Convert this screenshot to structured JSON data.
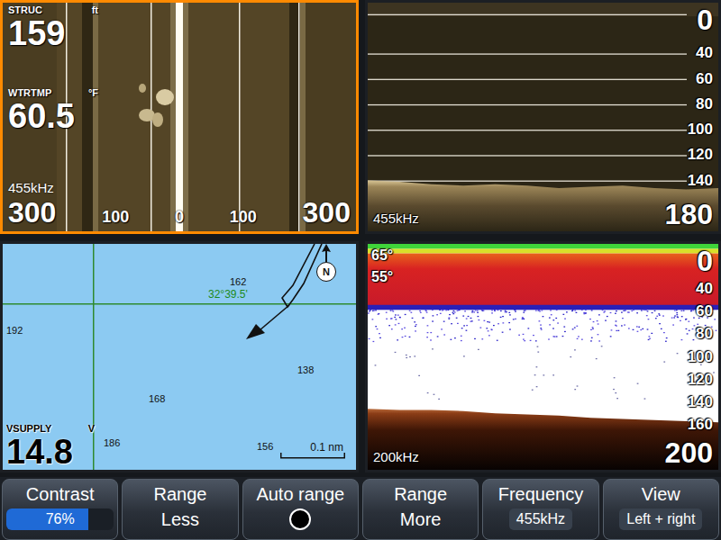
{
  "panels": {
    "structure": {
      "selected": true,
      "readouts": [
        {
          "label": "STRUC",
          "unit": "ft",
          "value": "159"
        },
        {
          "label": "WTRTMP",
          "unit": "°F",
          "value": "60.5"
        }
      ],
      "frequency": "455kHz",
      "scale": [
        "300",
        "100",
        "0",
        "100",
        "300"
      ]
    },
    "downscan": {
      "selected": false,
      "frequency": "455kHz",
      "range_top": "0",
      "range_bottom": "180",
      "ticks": [
        "40",
        "60",
        "80",
        "100",
        "120",
        "140"
      ],
      "bottom_depth": [
        140,
        141,
        143,
        144,
        143,
        144,
        146,
        145,
        144,
        146,
        147,
        146
      ]
    },
    "map": {
      "selected": false,
      "soundings": [
        "162",
        "192",
        "138",
        "168",
        "156",
        "186"
      ],
      "latitude": "32°39.5'",
      "north": "N",
      "scale": "0.1 nm",
      "readout": {
        "label": "VSUPPLY",
        "unit": "V",
        "value": "14.8"
      }
    },
    "sonar": {
      "selected": false,
      "frequency": "200kHz",
      "range_top": "0",
      "range_bottom": "200",
      "temperatures": [
        "65°",
        "55°"
      ],
      "ticks": [
        "40",
        "60",
        "80",
        "100",
        "120",
        "140",
        "160"
      ],
      "bottom_depth": [
        146,
        147,
        147,
        148,
        150,
        151,
        152,
        154,
        155,
        156,
        157,
        158
      ]
    }
  },
  "buttons": [
    {
      "label": "Contrast",
      "kind": "slider",
      "value": "76%",
      "level": 0.76
    },
    {
      "label": "Range",
      "kind": "text",
      "value": "Less"
    },
    {
      "label": "Auto range",
      "kind": "toggle",
      "on": false
    },
    {
      "label": "Range",
      "kind": "text",
      "value": "More"
    },
    {
      "label": "Frequency",
      "kind": "option",
      "value": "455kHz"
    },
    {
      "label": "View",
      "kind": "option",
      "value": "Left + right"
    }
  ]
}
